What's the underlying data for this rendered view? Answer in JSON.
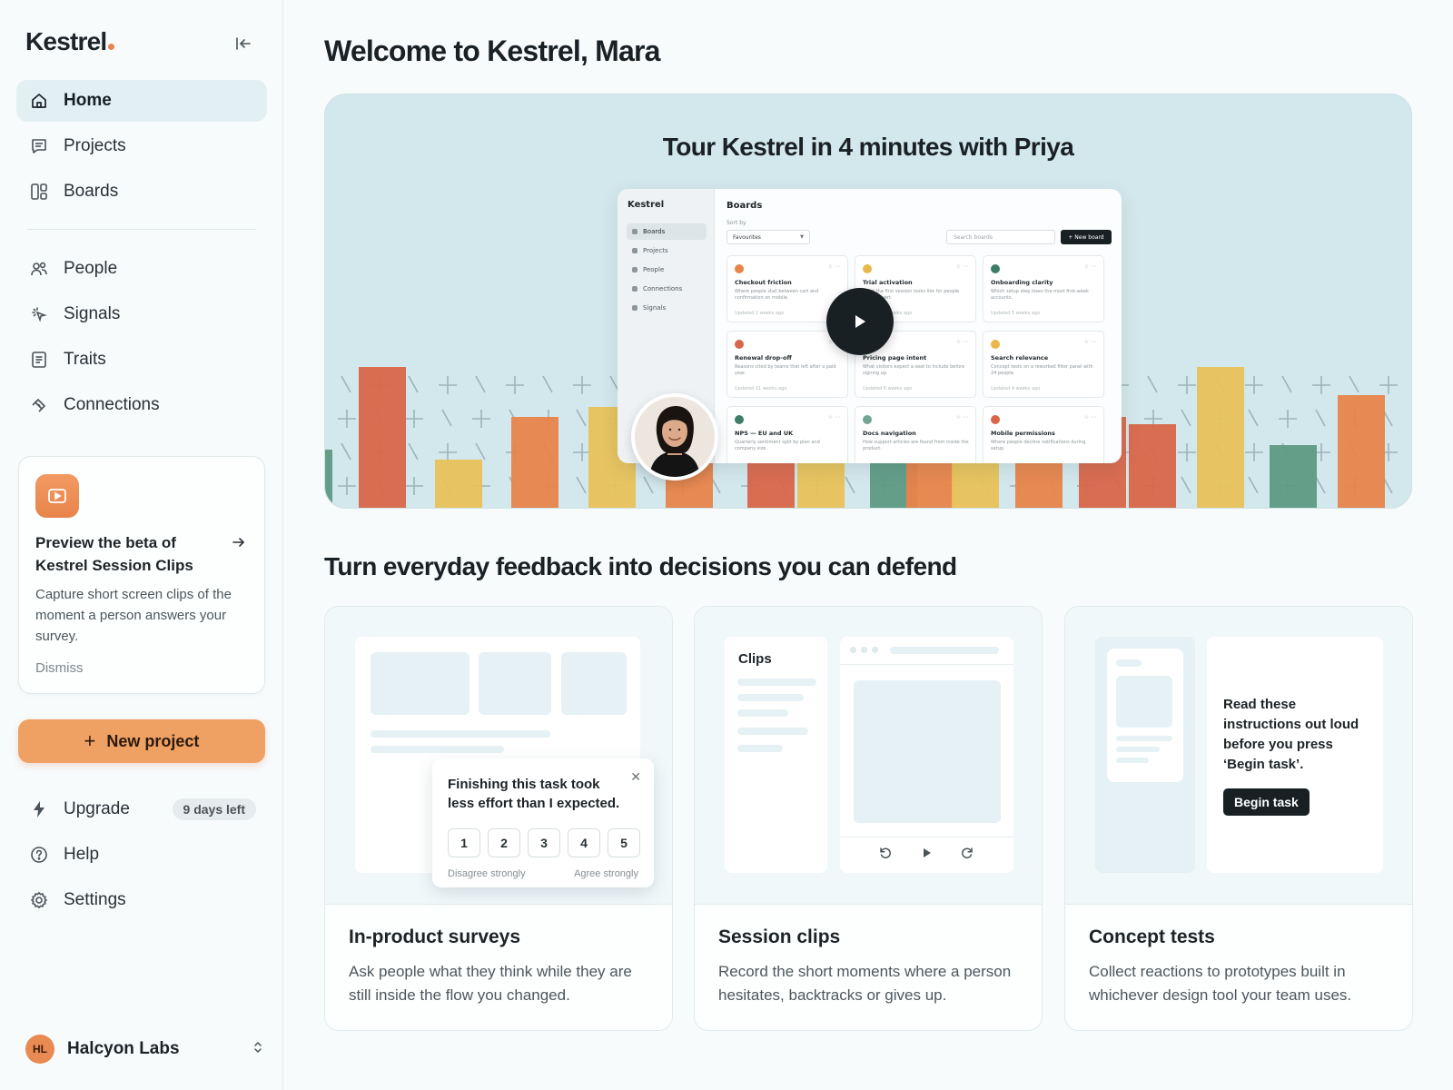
{
  "app": {
    "logo_text": "Kestrel"
  },
  "sidebar": {
    "primary_nav": [
      {
        "label": "Home",
        "icon": "home-icon",
        "active": true
      },
      {
        "label": "Projects",
        "icon": "projects-icon"
      },
      {
        "label": "Boards",
        "icon": "boards-icon"
      }
    ],
    "secondary_nav": [
      {
        "label": "People",
        "icon": "people-icon"
      },
      {
        "label": "Signals",
        "icon": "signals-icon"
      },
      {
        "label": "Traits",
        "icon": "traits-icon"
      },
      {
        "label": "Connections",
        "icon": "connections-icon"
      }
    ],
    "promo": {
      "title": "Preview the beta of Kestrel Session Clips",
      "body": "Capture short screen clips of the moment a person answers your survey.",
      "dismiss": "Dismiss"
    },
    "new_project_label": "New project",
    "footer_nav": {
      "upgrade": "Upgrade",
      "upgrade_badge": "9 days left",
      "help": "Help",
      "settings": "Settings"
    },
    "workspace": {
      "initials": "HL",
      "name": "Halcyon Labs"
    }
  },
  "main": {
    "welcome": "Welcome to Kestrel, Mara",
    "hero": {
      "title": "Tour Kestrel in 4 minutes with Priya",
      "preview": {
        "logo": "Kestrel",
        "nav": [
          "Boards",
          "Projects",
          "People",
          "Connections",
          "Signals"
        ],
        "page_title": "Boards",
        "sort_label": "Sort by",
        "sort_value": "Favourites",
        "search_placeholder": "Search boards",
        "new_board": "+ New board",
        "cards": [
          {
            "title": "Checkout friction",
            "desc": "Where people stall between cart and confirmation on mobile.",
            "updated": "Updated 2 weeks ago",
            "color": "#e8844a"
          },
          {
            "title": "Trial activation",
            "desc": "What the first session looks like for people who convert.",
            "updated": "Updated 3 weeks ago",
            "color": "#e8b94a"
          },
          {
            "title": "Onboarding clarity",
            "desc": "Which setup step loses the most first-week accounts.",
            "updated": "Updated 5 weeks ago",
            "color": "#3f7d68"
          },
          {
            "title": "Renewal drop-off",
            "desc": "Reasons cited by teams that left after a paid year.",
            "updated": "Updated 11 weeks ago",
            "color": "#d9664a"
          },
          {
            "title": "Pricing page intent",
            "desc": "What visitors expect a seat to include before signing up.",
            "updated": "Updated 6 weeks ago",
            "color": "#3f7d68"
          },
          {
            "title": "Search relevance",
            "desc": "Concept tests on a reworked filter panel with 24 people.",
            "updated": "Updated 4 weeks ago",
            "color": "#e8b94a"
          },
          {
            "title": "NPS — EU and UK",
            "desc": "Quarterly sentiment split by plan and company size.",
            "updated": "",
            "color": "#3f7d68"
          },
          {
            "title": "Docs navigation",
            "desc": "How support articles are found from inside the product.",
            "updated": "",
            "color": "#6fa592"
          },
          {
            "title": "Mobile permissions",
            "desc": "Where people decline notifications during setup.",
            "updated": "",
            "color": "#d9664a"
          }
        ]
      }
    },
    "section_title": "Turn everyday feedback into decisions you can defend",
    "features": [
      {
        "title": "In-product surveys",
        "desc": "Ask people what they think while they are still inside the flow you changed."
      },
      {
        "title": "Session clips",
        "desc": "Record the short moments where a person hesitates, backtracks or gives up."
      },
      {
        "title": "Concept tests",
        "desc": "Collect reactions to prototypes built in whichever design tool your team uses."
      }
    ],
    "survey_widget": {
      "question": "Finishing this task took less effort than I expected.",
      "scale": [
        "1",
        "2",
        "3",
        "4",
        "5"
      ],
      "low_label": "Disagree strongly",
      "high_label": "Agree strongly"
    },
    "clips_widget": {
      "label": "Clips"
    },
    "concept_widget": {
      "instructions": "Read these instructions out loud before you press ‘Begin task’.",
      "button": "Begin task"
    }
  },
  "colors": {
    "accent": "#efa063",
    "brand_dot": "#e8844a",
    "hero_bg": "#d3e8ec",
    "bar_orange": "#e8844a",
    "bar_red": "#d9664a",
    "bar_yellow": "#e8c25a",
    "bar_green": "#5e9a84"
  }
}
